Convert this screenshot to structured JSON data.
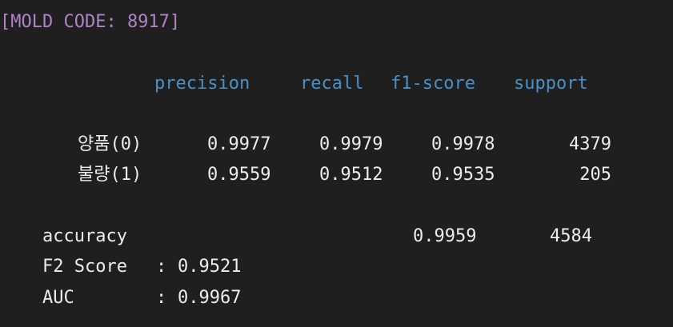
{
  "header": {
    "text": "[MOLD CODE: 8917]",
    "color": "#b083c9"
  },
  "columns": {
    "precision": "precision",
    "recall": "recall",
    "f1": "f1-score",
    "support": "support",
    "color": "#4a90c8"
  },
  "rows": [
    {
      "label": "양품(0)",
      "precision": "0.9977",
      "recall": "0.9979",
      "f1": "0.9978",
      "support": "4379"
    },
    {
      "label": "불량(1)",
      "precision": "0.9559",
      "recall": "0.9512",
      "f1": "0.9535",
      "support": "205"
    }
  ],
  "accuracy": {
    "label": "accuracy",
    "f1": "0.9959",
    "support": "4584"
  },
  "f2": {
    "label": "F2 Score",
    "sep": ":",
    "value": "0.9521"
  },
  "auc": {
    "label": "AUC",
    "sep": ":",
    "value": "0.9967"
  }
}
